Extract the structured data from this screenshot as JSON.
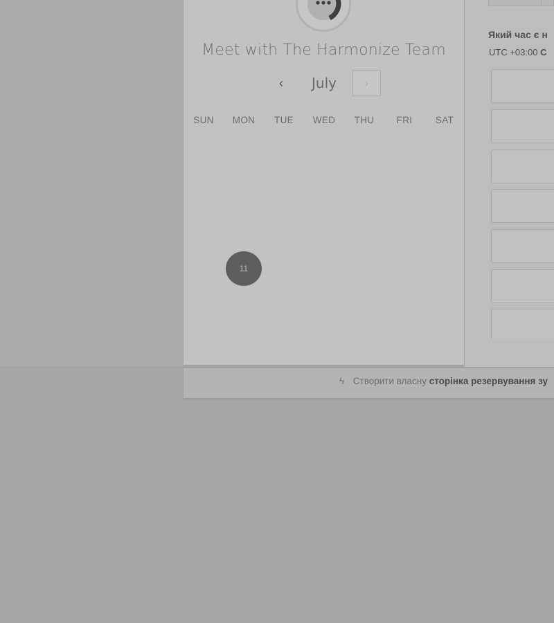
{
  "scheduler": {
    "title": "Meet with The Harmonize Team",
    "month": "July",
    "prev_icon": "chevron-left-icon",
    "next_icon": "chevron-right-icon",
    "weekdays": [
      "SUN",
      "MON",
      "TUE",
      "WED",
      "THU",
      "FRI",
      "SAT"
    ],
    "selected_day": "11"
  },
  "times_panel": {
    "question": "Який час є н",
    "timezone_prefix": "UTC +03:00",
    "timezone_rest": "С",
    "slot_count": 7
  },
  "footer": {
    "icon": "hubspot-sprocket-icon",
    "text_plain": "Створити власну",
    "text_bold": "сторінка резервування зу"
  },
  "colors": {
    "overlay": "#aaaaaa",
    "panel": "#c2c2c2",
    "selected_day": "#5e5e5e"
  }
}
